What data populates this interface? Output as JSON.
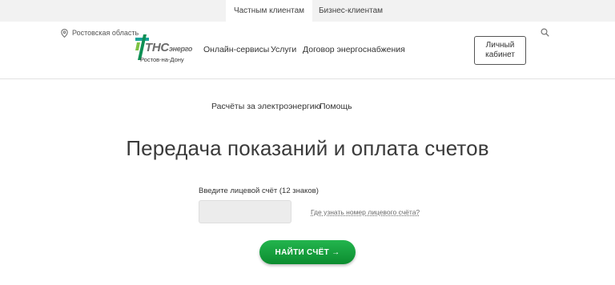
{
  "topbar": {
    "tabs": [
      {
        "label": "Частным клиентам",
        "active": true
      },
      {
        "label": "Бизнес-клиентам",
        "active": false
      }
    ]
  },
  "header": {
    "region": "Ростовская область",
    "logo": {
      "brand_main": "ТНС",
      "brand_sub": "энерго",
      "city": "Ростов-на-Дону"
    },
    "nav": [
      {
        "label": "Онлайн-сервисы"
      },
      {
        "label": "Услуги"
      },
      {
        "label": "Договор энергоснабжения"
      }
    ],
    "cabinet_label": "Личный кабинет",
    "icons": {
      "region": "location-pin-icon",
      "search": "search-icon"
    }
  },
  "sublinks": [
    {
      "label": "Расчёты за электроэнергию"
    },
    {
      "label": "Помощь"
    }
  ],
  "main": {
    "title": "Передача показаний и оплата счетов",
    "field_label": "Введите лицевой счёт (12 знаков)",
    "account_value": "",
    "help_link": "Где узнать номер лицевого счёта?",
    "submit_label": "НАЙТИ СЧЁТ →"
  },
  "colors": {
    "accent_green": "#12a03c",
    "logo_teal": "#1aa39a",
    "topbar_bg": "#f2f2f2"
  }
}
